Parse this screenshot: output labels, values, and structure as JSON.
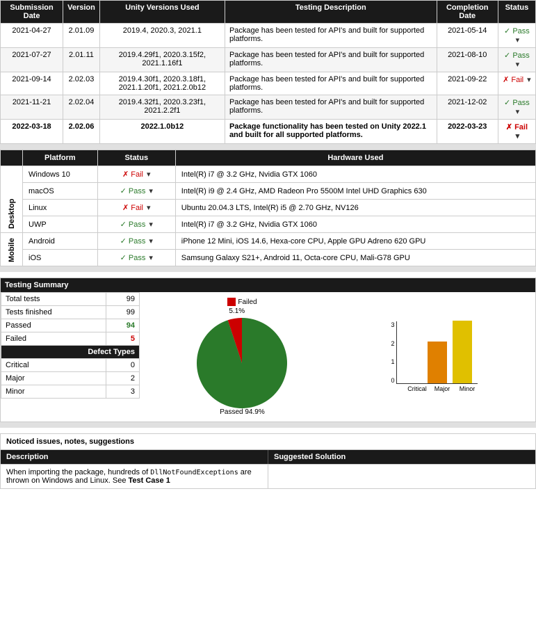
{
  "topTable": {
    "headers": [
      "Submission Date",
      "Version",
      "Unity Versions Used",
      "Testing Description",
      "Completion Date",
      "Status"
    ],
    "rows": [
      {
        "submissionDate": "2021-04-27",
        "version": "2.01.09",
        "unityVersions": "2019.4, 2020.3, 2021.1",
        "description": "Package has been tested for API's and built for supported platforms.",
        "completionDate": "2021-05-14",
        "status": "Pass",
        "statusType": "pass"
      },
      {
        "submissionDate": "2021-07-27",
        "version": "2.01.11",
        "unityVersions": "2019.4.29f1, 2020.3.15f2, 2021.1.16f1",
        "description": "Package has been tested for API's and built for supported platforms.",
        "completionDate": "2021-08-10",
        "status": "Pass",
        "statusType": "pass"
      },
      {
        "submissionDate": "2021-09-14",
        "version": "2.02.03",
        "unityVersions": "2019.4.30f1, 2020.3.18f1, 2021.1.20f1, 2021.2.0b12",
        "description": "Package has been tested for API's and built for supported platforms.",
        "completionDate": "2021-09-22",
        "status": "Fail",
        "statusType": "fail"
      },
      {
        "submissionDate": "2021-11-21",
        "version": "2.02.04",
        "unityVersions": "2019.4.32f1, 2020.3.23f1, 2021.2.2f1",
        "description": "Package has been tested for API's and built for supported platforms.",
        "completionDate": "2021-12-02",
        "status": "Pass",
        "statusType": "pass"
      },
      {
        "submissionDate": "2022-03-18",
        "version": "2.02.06",
        "unityVersions": "2022.1.0b12",
        "description": "Package functionality has been tested on Unity 2022.1 and built for all supported platforms.",
        "completionDate": "2022-03-23",
        "status": "Fail",
        "statusType": "fail",
        "bold": true
      }
    ]
  },
  "platformTable": {
    "headers": [
      "Platform",
      "Status",
      "Hardware Used"
    ],
    "groups": [
      {
        "label": "Desktop",
        "rows": [
          {
            "platform": "Windows 10",
            "status": "Fail",
            "statusType": "fail",
            "hardware": "Intel(R) i7 @ 3.2 GHz, Nvidia GTX 1060"
          },
          {
            "platform": "macOS",
            "status": "Pass",
            "statusType": "pass",
            "hardware": "Intel(R) i9 @ 2.4 GHz, AMD Radeon Pro 5500M Intel UHD Graphics 630"
          },
          {
            "platform": "Linux",
            "status": "Fail",
            "statusType": "fail",
            "hardware": "Ubuntu 20.04.3 LTS, Intel(R) i5 @ 2.70 GHz, NV126"
          },
          {
            "platform": "UWP",
            "status": "Pass",
            "statusType": "pass",
            "hardware": "Intel(R) i7 @ 3.2 GHz, Nvidia GTX 1060"
          }
        ]
      },
      {
        "label": "Mobile",
        "rows": [
          {
            "platform": "Android",
            "status": "Pass",
            "statusType": "pass",
            "hardware": "iPhone 12 Mini, iOS 14.6, Hexa-core CPU, Apple GPU Adreno 620 GPU"
          },
          {
            "platform": "iOS",
            "status": "Pass",
            "statusType": "pass",
            "hardware": "Samsung Galaxy S21+, Android 11, Octa-core CPU, Mali-G78 GPU"
          }
        ]
      }
    ]
  },
  "summary": {
    "title": "Testing Summary",
    "rows": [
      {
        "label": "Total tests",
        "value": "99",
        "type": "normal"
      },
      {
        "label": "Tests finished",
        "value": "99",
        "type": "normal"
      },
      {
        "label": "Passed",
        "value": "94",
        "type": "green"
      },
      {
        "label": "Failed",
        "value": "5",
        "type": "red"
      }
    ],
    "defectTitle": "Defect Types",
    "defectRows": [
      {
        "label": "Critical",
        "value": "0",
        "type": "normal"
      },
      {
        "label": "Major",
        "value": "2",
        "type": "normal"
      },
      {
        "label": "Minor",
        "value": "3",
        "type": "normal"
      }
    ],
    "pie": {
      "failedPct": "5.1%",
      "passedPct": "94.9%",
      "failedLabel": "Failed",
      "passedLabel": "Passed"
    },
    "barChart": {
      "yLabels": [
        "3",
        "2",
        "1",
        "0"
      ],
      "bars": [
        {
          "label": "Critical",
          "value": 0,
          "maxValue": 3,
          "color": "#e05c00"
        },
        {
          "label": "Major",
          "value": 2,
          "maxValue": 3,
          "color": "#e08000"
        },
        {
          "label": "Minor",
          "value": 3,
          "maxValue": 3,
          "color": "#e0c000"
        }
      ]
    }
  },
  "notes": {
    "title": "Noticed issues, notes, suggestions",
    "headers": [
      "Description",
      "Suggested Solution"
    ],
    "rows": [
      {
        "description": "When importing the package, hundreds of DllNotFoundExceptions are thrown on Windows and Linux. See Test Case 1",
        "solution": ""
      }
    ]
  }
}
